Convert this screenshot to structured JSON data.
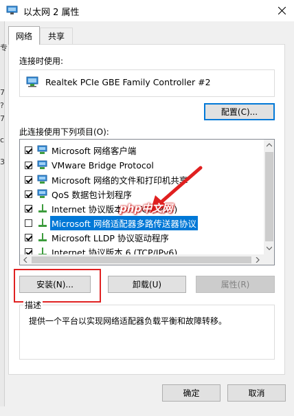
{
  "window": {
    "title": "以太网 2 属性",
    "close_symbol": "✕"
  },
  "backdrop": {
    "fragments": [
      "专",
      "7",
      "?",
      "7",
      "c",
      "3"
    ]
  },
  "tabs": [
    {
      "label": "网络"
    },
    {
      "label": "共享"
    }
  ],
  "connection": {
    "label": "连接时使用:",
    "adapter": "Realtek PCIe GBE Family Controller #2"
  },
  "buttons": {
    "configure": "配置(C)...",
    "install": "安装(N)...",
    "uninstall": "卸载(U)",
    "properties": "属性(R)",
    "ok": "确定",
    "cancel": "取消"
  },
  "items_label": "此连接使用下列项目(O):",
  "items": [
    {
      "label": "Microsoft 网络客户端",
      "checked": true,
      "icon": "network-client-icon"
    },
    {
      "label": "VMware Bridge Protocol",
      "checked": true,
      "icon": "network-service-icon"
    },
    {
      "label": "Microsoft 网络的文件和打印机共享",
      "checked": true,
      "icon": "network-service-icon"
    },
    {
      "label": "QoS 数据包计划程序",
      "checked": true,
      "icon": "network-service-icon"
    },
    {
      "label": "Internet 协议版本 4 (TCP/IPv4)",
      "checked": true,
      "icon": "protocol-icon"
    },
    {
      "label": "Microsoft 网络适配器多路传送器协议",
      "checked": false,
      "icon": "protocol-icon",
      "selected": true
    },
    {
      "label": "Microsoft LLDP 协议驱动程序",
      "checked": true,
      "icon": "protocol-icon"
    },
    {
      "label": "Internet 协议版本 6 (TCP/IPv6)",
      "checked": true,
      "icon": "protocol-icon"
    }
  ],
  "description": {
    "label": "描述",
    "text": "提供一个平台以实现网络适配器负载平衡和故障转移。"
  },
  "watermark": "php中文网",
  "colors": {
    "accent": "#0078d7",
    "highlight_box": "#e02020"
  }
}
